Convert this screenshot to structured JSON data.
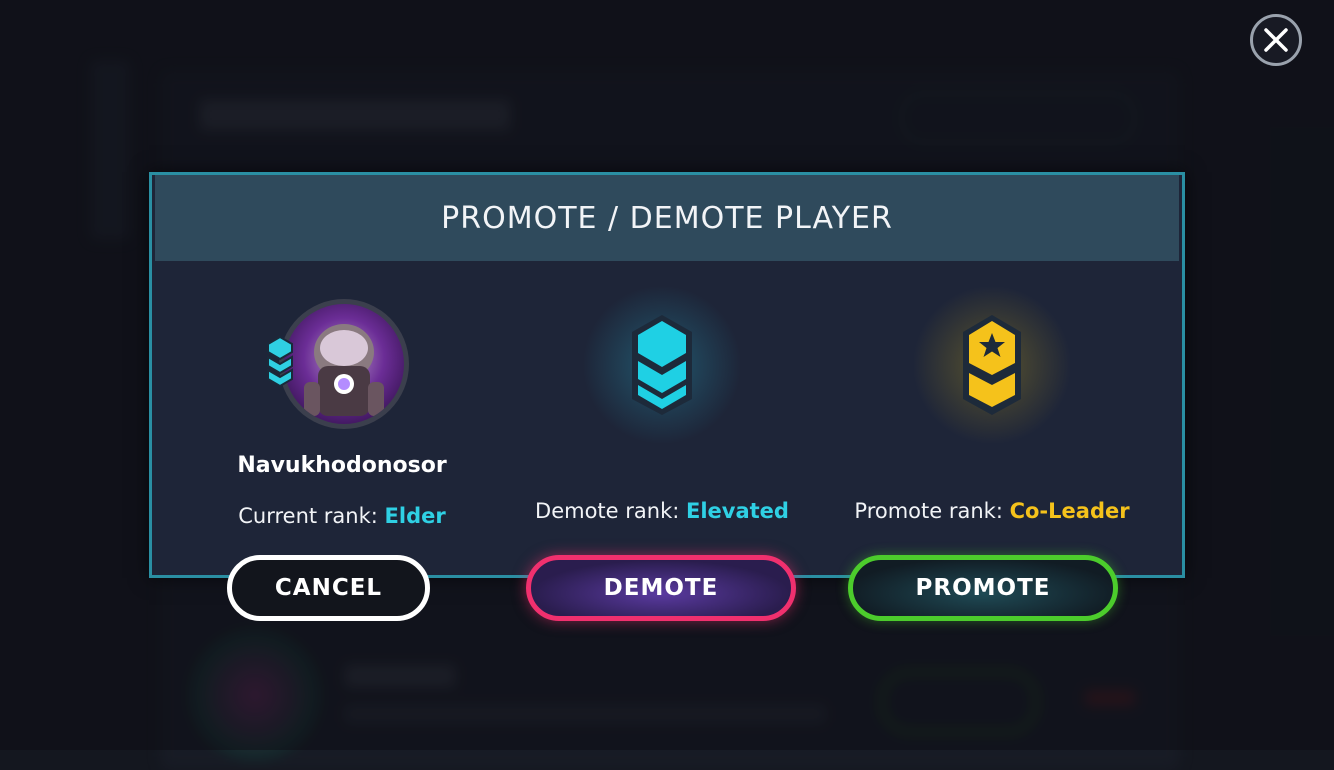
{
  "dialog": {
    "title": "PROMOTE / DEMOTE PLAYER"
  },
  "player": {
    "name": "Navukhodonosor",
    "current_rank_label": "Current rank:",
    "current_rank_value": "Elder"
  },
  "demote": {
    "rank_label": "Demote rank:",
    "rank_value": "Elevated"
  },
  "promote": {
    "rank_label": "Promote rank:",
    "rank_value": "Co-Leader"
  },
  "buttons": {
    "cancel": "CANCEL",
    "demote": "DEMOTE",
    "promote": "PROMOTE"
  },
  "icons": {
    "close": "close-icon",
    "player_rank": "elder-rank-icon",
    "demote_rank": "elevated-rank-icon",
    "promote_rank": "co-leader-rank-icon"
  },
  "colors": {
    "dialog_border": "#2a8fa3",
    "header_bg": "#2f4a5c",
    "cyan_rank": "#2fd0e4",
    "gold_rank": "#f5c21b",
    "demote_border": "#f0306e",
    "promote_border": "#4ccc2c"
  }
}
